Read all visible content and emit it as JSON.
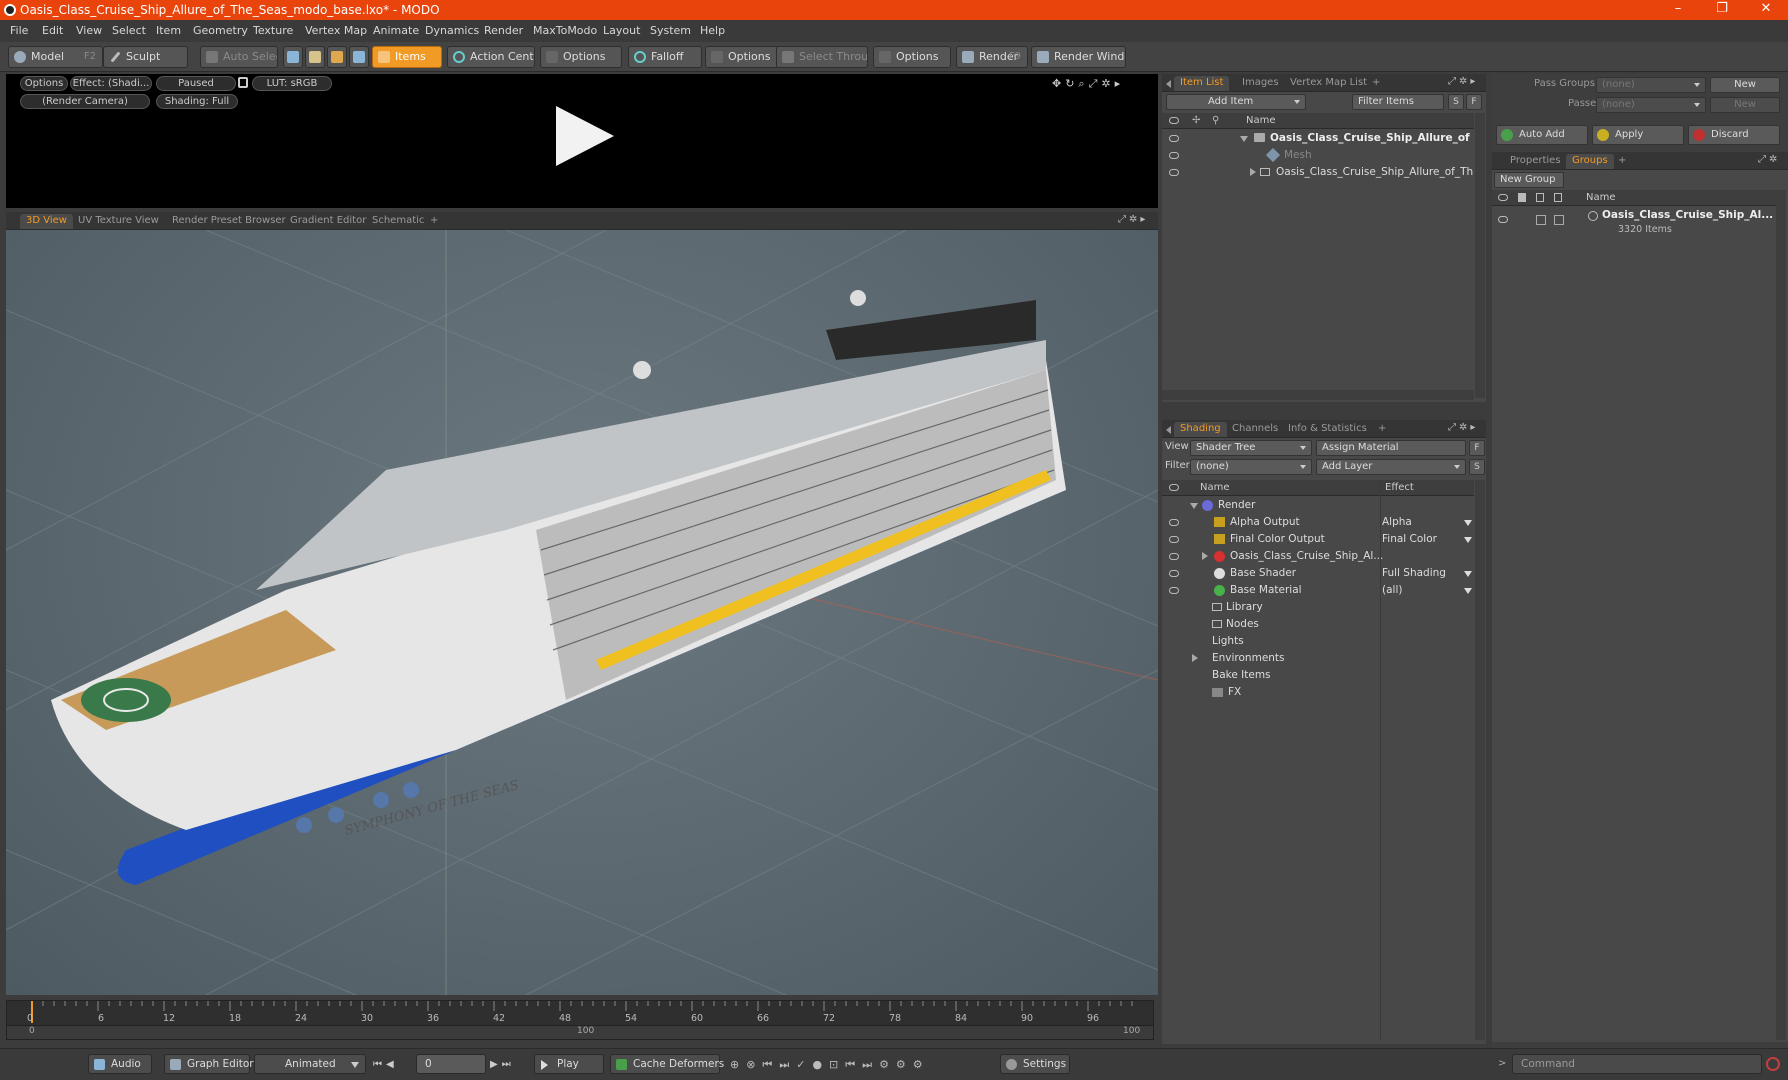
{
  "window": {
    "title": "Oasis_Class_Cruise_Ship_Allure_of_The_Seas_modo_base.lxo* - MODO",
    "controls": {
      "minimize": "–",
      "restore": "❐",
      "close": "✕"
    }
  },
  "menu": [
    "File",
    "Edit",
    "View",
    "Select",
    "Item",
    "Geometry",
    "Texture",
    "Vertex Map",
    "Animate",
    "Dynamics",
    "Render",
    "MaxToModo",
    "Layout",
    "System",
    "Help"
  ],
  "toolbar": {
    "model": "Model",
    "model_key": "F2",
    "sculpt": "Sculpt",
    "auto_select": "Auto Select",
    "items": "Items",
    "action_center": "Action Center",
    "options1": "Options",
    "falloff": "Falloff",
    "options2": "Options",
    "select_through": "Select Through",
    "options3": "Options",
    "render": "Render",
    "render_key": "F9",
    "render_window": "Render Window"
  },
  "render_preview": {
    "options": "Options",
    "effect": "Effect: (Shadi...",
    "paused": "Paused",
    "lut": "LUT: sRGB",
    "camera": "(Render Camera)",
    "shading": "Shading: Full"
  },
  "view_tabs": [
    "3D View",
    "UV Texture View",
    "Render Preset Browser",
    "Gradient Editor",
    "Schematic",
    "+"
  ],
  "viewport": {
    "ship_name": "SYMPHONY OF THE SEAS"
  },
  "item_list": {
    "tabs": [
      "Item List",
      "Images",
      "Vertex Map List",
      "+"
    ],
    "add_item": "Add Item",
    "filter_items": "Filter Items",
    "s_btn": "S",
    "f_btn": "F",
    "col_name": "Name",
    "rows": [
      {
        "label": "Oasis_Class_Cruise_Ship_Allure_of ..."
      },
      {
        "label": "Mesh"
      },
      {
        "label": "Oasis_Class_Cruise_Ship_Allure_of_Th ..."
      }
    ]
  },
  "shading": {
    "tabs": [
      "Shading",
      "Channels",
      "Info & Statistics",
      "+"
    ],
    "view_label": "View",
    "view_value": "Shader Tree",
    "assign_material": "Assign Material",
    "f_btn": "F",
    "filter_label": "Filter",
    "filter_value": "(none)",
    "add_layer": "Add Layer",
    "s_btn": "S",
    "col_name": "Name",
    "col_effect": "Effect",
    "rows": [
      {
        "label": "Render",
        "effect": ""
      },
      {
        "label": "Alpha Output",
        "effect": "Alpha"
      },
      {
        "label": "Final Color Output",
        "effect": "Final Color"
      },
      {
        "label": "Oasis_Class_Cruise_Ship_Al...",
        "effect": ""
      },
      {
        "label": "Base Shader",
        "effect": "Full Shading"
      },
      {
        "label": "Base Material",
        "effect": "(all)"
      },
      {
        "label": "Library",
        "effect": ""
      },
      {
        "label": "Nodes",
        "effect": ""
      },
      {
        "label": "Lights",
        "effect": ""
      },
      {
        "label": "Environments",
        "effect": ""
      },
      {
        "label": "Bake Items",
        "effect": ""
      },
      {
        "label": "FX",
        "effect": ""
      }
    ]
  },
  "groups": {
    "pass_groups_label": "Pass Groups",
    "pass_groups_value": "(none)",
    "new": "New",
    "passes_label": "Passes",
    "passes_value": "(none)",
    "new2": "New",
    "auto_add": "Auto Add",
    "apply": "Apply",
    "discard": "Discard",
    "tabs": [
      "Properties",
      "Groups",
      "+"
    ],
    "new_group": "New Group",
    "col_name": "Name",
    "group_name": "Oasis_Class_Cruise_Ship_Al...",
    "group_count": "3320 Items"
  },
  "timeline": {
    "ticks": [
      "0",
      "6",
      "12",
      "18",
      "24",
      "30",
      "36",
      "42",
      "48",
      "54",
      "60",
      "66",
      "72",
      "78",
      "84",
      "90",
      "96"
    ],
    "range_start": "0",
    "range_mid": "100",
    "range_end": "100"
  },
  "bottom": {
    "audio": "Audio",
    "graph_editor": "Graph Editor",
    "animated": "Animated",
    "frame": "0",
    "play": "Play",
    "cache_deformers": "Cache Deformers",
    "settings": "Settings",
    "command": "Command"
  },
  "colors": {
    "accent": "#f29a26",
    "titlebar": "#e8440c"
  }
}
